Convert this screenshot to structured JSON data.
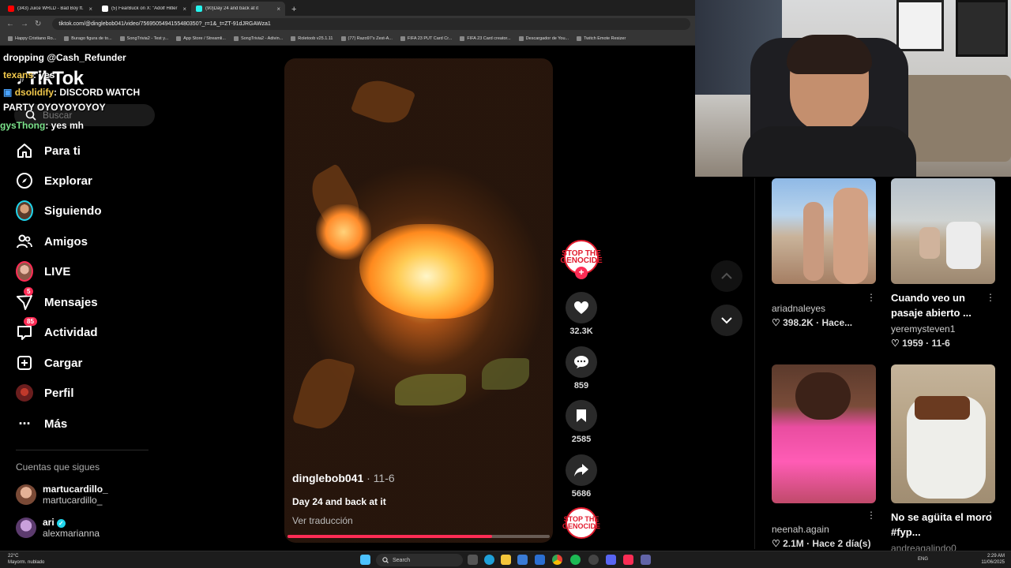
{
  "browser": {
    "tabs": [
      {
        "title": "(343) Juice WRLD - Bad Boy ft.",
        "color": "#ff0000"
      },
      {
        "title": "(5) FearBuck on X: \"Adolf Hitler",
        "color": "#ffffff"
      },
      {
        "title": "(90)Day 24 and back at it",
        "color": "#25f4ee"
      }
    ],
    "url": "tiktok.com/@dinglebob041/video/7569505494155480350?_r=1&_t=ZT-91dJRGAWza1",
    "bookmarks": [
      "Happy Cristiano Ro...",
      "Burago figura de to...",
      "SongTrivia2 - Test y...",
      "App Store / Streamli...",
      "SongTrivia2 - Adivin...",
      "Roletoob v25.1.11",
      "(77) Razo97's Zest-A...",
      "FIFA 23 PUT Card Cr...",
      "FIFA 23 Card creator...",
      "Descargador de You...",
      "Twitch Emote Resizer"
    ]
  },
  "chat": [
    {
      "user": "",
      "text": "dropping @Cash_Refunder"
    },
    {
      "user": "texans",
      "text": ": yes"
    },
    {
      "user": "dsolidify",
      "text": ": DISCORD WATCH"
    },
    {
      "user": "",
      "text": "PARTY OYOYOYOYOY"
    },
    {
      "user": "gysThong",
      "text": ": yes mh"
    }
  ],
  "sidebar": {
    "logo": "TikTok",
    "search_placeholder": "Buscar",
    "items": [
      {
        "label": "Para ti",
        "icon": "home-icon"
      },
      {
        "label": "Explorar",
        "icon": "compass-icon"
      },
      {
        "label": "Siguiendo",
        "icon": "following-avatar"
      },
      {
        "label": "Amigos",
        "icon": "friends-icon"
      },
      {
        "label": "LIVE",
        "icon": "live-avatar"
      },
      {
        "label": "Mensajes",
        "icon": "messages-icon",
        "badge": "5"
      },
      {
        "label": "Actividad",
        "icon": "activity-icon",
        "badge": "85"
      },
      {
        "label": "Cargar",
        "icon": "upload-icon"
      },
      {
        "label": "Perfil",
        "icon": "profile-avatar"
      },
      {
        "label": "Más",
        "icon": "more-icon"
      }
    ],
    "following_heading": "Cuentas que sigues",
    "accounts": [
      {
        "name": "martucardillo_",
        "handle": "martucardillo_",
        "verified": false
      },
      {
        "name": "ari",
        "handle": "alexmarianna",
        "verified": true
      }
    ]
  },
  "video": {
    "username": "dinglebob041",
    "date": " · 11-6",
    "caption": "Day 24 and back at it",
    "translate_label": "Ver traducción",
    "progress": 0.78,
    "creator_badge": "STOP THE GENOCIDE",
    "likes": "32.3K",
    "comments": "859",
    "saves": "2585",
    "shares": "5686"
  },
  "recommendations": [
    {
      "user": "ariadnaleyes",
      "title": "",
      "stats": "♡ 398.2K · Hace..."
    },
    {
      "user": "yeremysteven1",
      "title": "Cuando veo un pasaje abierto ...",
      "stats": "♡ 1959 · 11-6"
    },
    {
      "user": "neenah.again",
      "title": "",
      "stats": "♡ 2.1M · Hace 2 día(s)"
    },
    {
      "user": "andreagalindo0",
      "title": "No se agüita el moro #fyp...",
      "stats": ""
    }
  ],
  "taskbar": {
    "weather_temp": "22°C",
    "weather_desc": "Mayorm. nublado",
    "search_label": "Search",
    "language": "ENG",
    "time": "2:29 AM",
    "date": "11/06/2025"
  }
}
